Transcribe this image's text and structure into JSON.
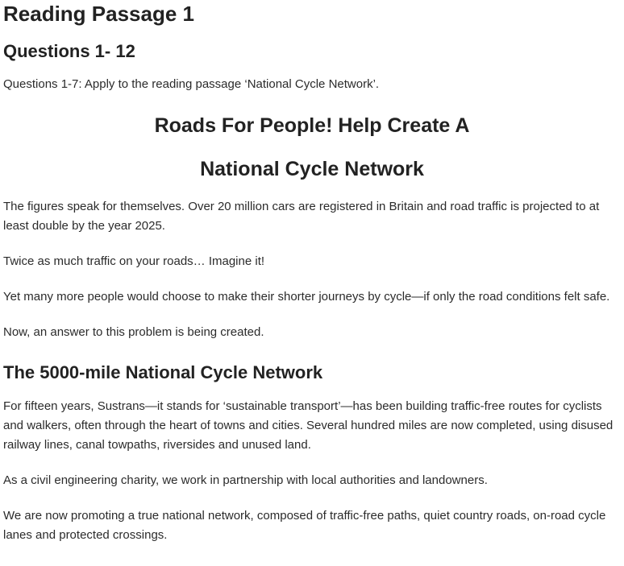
{
  "heading": "Reading Passage 1",
  "questions_heading": "Questions 1- 12",
  "instructions": "Questions 1-7: Apply to the reading passage ‘National Cycle Network’.",
  "article": {
    "title_line1": "Roads For People! Help Create A",
    "title_line2": "National Cycle Network",
    "paragraphs": [
      "The figures speak for themselves. Over 20 million cars are registered in Britain and road traffic is projected to at least double by the year 2025.",
      "Twice as much traffic on your roads… Imagine it!",
      "Yet many more people would choose to make their shorter journeys by cycle—if only the road conditions felt safe.",
      "Now, an answer to this problem is being created."
    ],
    "subheading": "The 5000-mile National Cycle Network",
    "section_paragraphs": [
      "For fifteen years, Sustrans—it stands for ‘sustainable transport’—has been building traffic-free routes for cyclists and walkers, often through the heart of towns and cities. Several hundred miles are now completed, using disused railway lines, canal towpaths, riversides and unused land.",
      "As a civil engineering charity, we work in partnership with local authorities and landowners.",
      "We are now promoting a true national network, composed of traffic-free paths, quiet country roads, on-road cycle lanes and protected crossings."
    ]
  }
}
